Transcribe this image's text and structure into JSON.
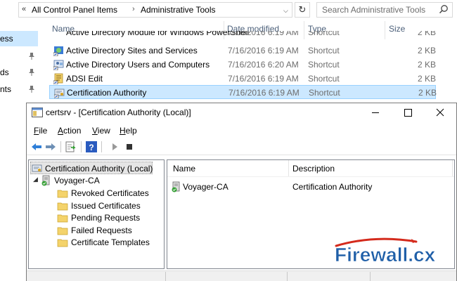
{
  "explorer": {
    "breadcrumb": [
      "All Control Panel Items",
      "Administrative Tools"
    ],
    "search_placeholder": "Search Administrative Tools",
    "nav_items": [
      "ess",
      "ds",
      "nts"
    ],
    "columns": {
      "name": "Name",
      "date": "Date modified",
      "type": "Type",
      "size": "Size"
    },
    "clipped_row": {
      "name": "Active Directory Module for Windows PowerShell",
      "date": "7/16/2016 6:19 AM",
      "type": "Shortcut",
      "size": "2 KB"
    },
    "files": [
      {
        "name": "Active Directory Sites and Services",
        "date": "7/16/2016 6:19 AM",
        "type": "Shortcut",
        "size": "2 KB"
      },
      {
        "name": "Active Directory Users and Computers",
        "date": "7/16/2016 6:20 AM",
        "type": "Shortcut",
        "size": "2 KB"
      },
      {
        "name": "ADSI Edit",
        "date": "7/16/2016 6:19 AM",
        "type": "Shortcut",
        "size": "2 KB"
      },
      {
        "name": "Certification Authority",
        "date": "7/16/2016 6:19 AM",
        "type": "Shortcut",
        "size": "2 KB"
      }
    ]
  },
  "mmc": {
    "title": "certsrv - [Certification Authority (Local)]",
    "menu": {
      "file": {
        "u": "F",
        "rest": "ile"
      },
      "action": {
        "u": "A",
        "rest": "ction"
      },
      "view": {
        "u": "V",
        "rest": "iew"
      },
      "help": {
        "u": "H",
        "rest": "elp"
      }
    },
    "tree": {
      "root": "Certification Authority (Local)",
      "ca": "Voyager-CA",
      "folders": [
        "Revoked Certificates",
        "Issued Certificates",
        "Pending Requests",
        "Failed Requests",
        "Certificate Templates"
      ]
    },
    "list": {
      "col_name": "Name",
      "col_desc": "Description",
      "rows": [
        {
          "name": "Voyager-CA",
          "desc": "Certification Authority"
        }
      ]
    }
  },
  "watermark": {
    "text_main": "Firewall",
    "text_suffix": ".cx"
  },
  "colors": {
    "selection": "#cce8ff",
    "header_text": "#4c607a",
    "watermark_blue": "#1f5fa8",
    "watermark_red": "#d42a1c"
  }
}
